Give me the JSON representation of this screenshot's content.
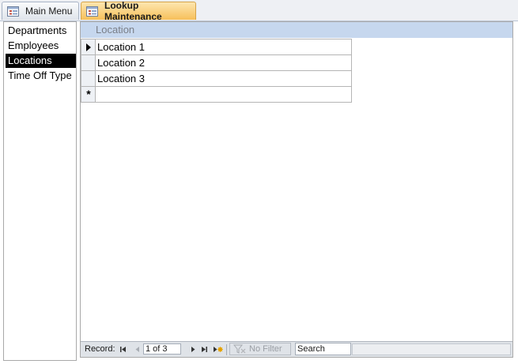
{
  "tabs": [
    {
      "label": "Main Menu",
      "icon": "form-icon",
      "active": false
    },
    {
      "label": "Lookup Maintenance",
      "icon": "form-icon",
      "active": true
    }
  ],
  "nav_list": {
    "items": [
      "Departments",
      "Employees",
      "Locations",
      "Time Off Type"
    ],
    "selected": "Locations"
  },
  "datasheet": {
    "column_header": "Location",
    "rows": [
      "Location 1",
      "Location 2",
      "Location 3"
    ],
    "new_row_marker": "*"
  },
  "record_nav": {
    "label": "Record:",
    "position": "1 of 3",
    "filter_label": "No Filter",
    "search_placeholder": "Search"
  },
  "colors": {
    "active_tab": "#f7c05a",
    "header_band": "#c6d7ee",
    "selected_item_bg": "#000000"
  }
}
